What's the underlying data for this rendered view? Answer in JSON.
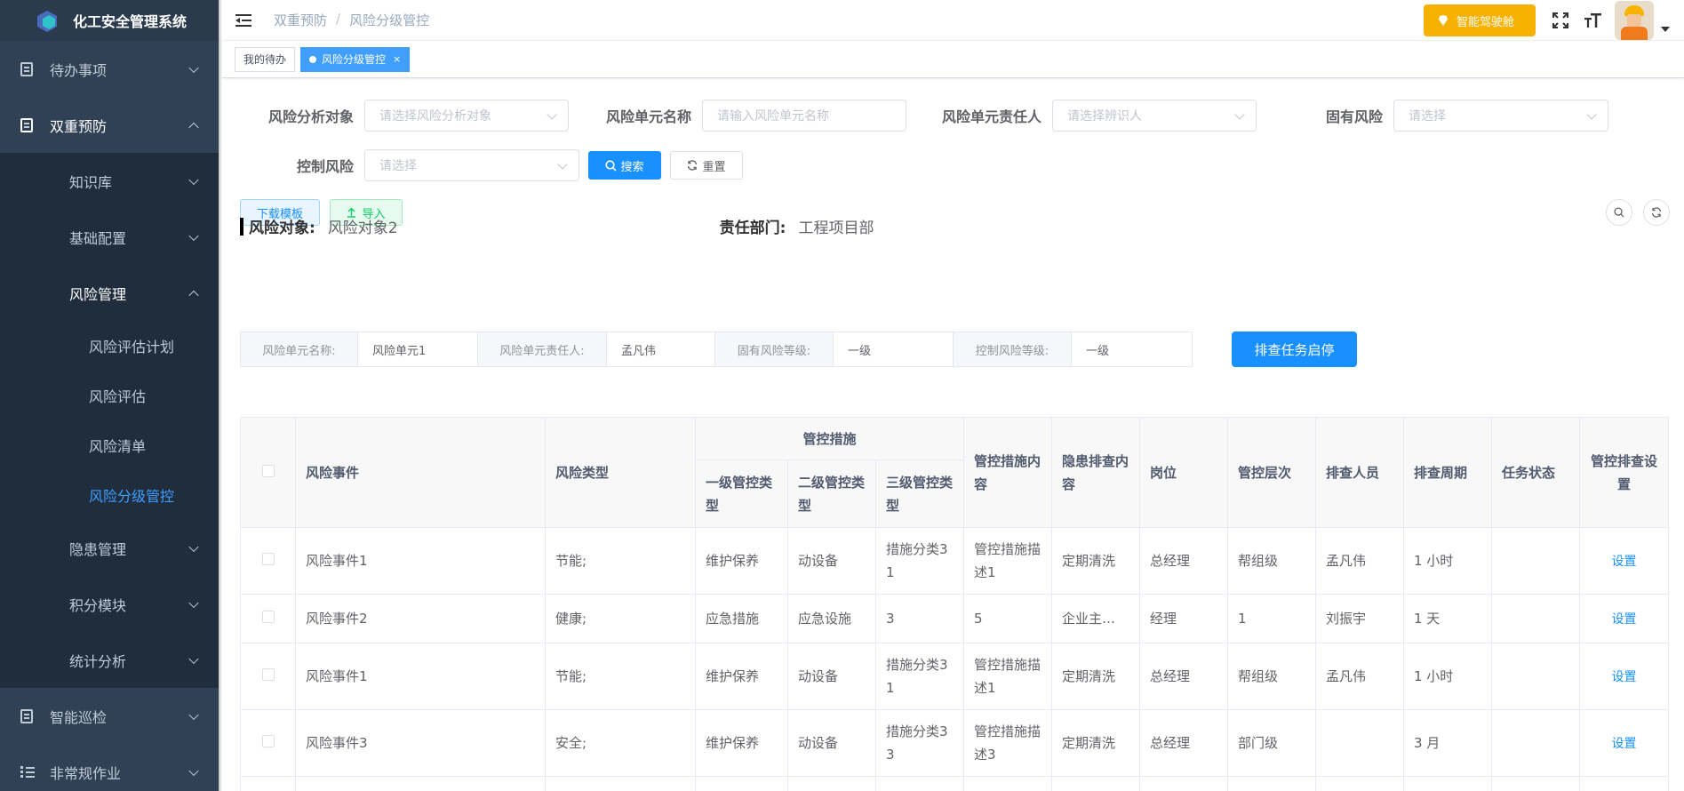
{
  "app": {
    "title": "化工安全管理系统"
  },
  "sidebar": {
    "items": [
      {
        "label": "待办事项"
      },
      {
        "label": "双重预防"
      },
      {
        "label": "知识库"
      },
      {
        "label": "基础配置"
      },
      {
        "label": "风险管理"
      },
      {
        "label": "风险评估计划"
      },
      {
        "label": "风险评估"
      },
      {
        "label": "风险清单"
      },
      {
        "label": "风险分级管控"
      },
      {
        "label": "隐患管理"
      },
      {
        "label": "积分模块"
      },
      {
        "label": "统计分析"
      },
      {
        "label": "智能巡检"
      },
      {
        "label": "非常规作业"
      }
    ]
  },
  "breadcrumb": [
    "双重预防",
    "风险分级管控"
  ],
  "header": {
    "smart_btn": "智能驾驶舱"
  },
  "tags": [
    {
      "label": "我的待办"
    },
    {
      "label": "风险分级管控",
      "close": "×"
    }
  ],
  "filters": {
    "object": {
      "label": "风险分析对象",
      "placeholder": "请选择风险分析对象"
    },
    "unit_name": {
      "label": "风险单元名称",
      "placeholder": "请输入风险单元名称"
    },
    "unit_owner": {
      "label": "风险单元责任人",
      "placeholder": "请选择辨识人"
    },
    "inherent": {
      "label": "固有风险",
      "placeholder": "请选择"
    },
    "control": {
      "label": "控制风险",
      "placeholder": "请选择"
    },
    "search": "搜索",
    "reset": "重置"
  },
  "toolbar": {
    "download": "下载模板",
    "import": "导入"
  },
  "risk_object": {
    "label": "风险对象:",
    "value": "风险对象2",
    "dept_label": "责任部门:",
    "dept_value": "工程项目部"
  },
  "unit_desc": {
    "name_label": "风险单元名称:",
    "name_value": "风险单元1",
    "owner_label": "风险单元责任人:",
    "owner_value": "孟凡伟",
    "inherent_label": "固有风险等级:",
    "inherent_value": "一级",
    "control_label": "控制风险等级:",
    "control_value": "一级",
    "task_btn": "排查任务启停"
  },
  "table": {
    "headers": {
      "event": "风险事件",
      "type": "风险类型",
      "measures": "管控措施",
      "l1": "一级管控类型",
      "l2": "二级管控类型",
      "l3": "三级管控类型",
      "content": "管控措施内容",
      "hazard": "隐患排查内容",
      "post": "岗位",
      "level": "管控层次",
      "person": "排查人员",
      "cycle": "排查周期",
      "status": "任务状态",
      "setting": "管控排查设置"
    },
    "rows": [
      {
        "event": "风险事件1",
        "type": "节能;",
        "l1": "维护保养",
        "l2": "动设备",
        "l3": "措施分类3 1",
        "content": "管控措施描述1",
        "hazard": "定期清洗",
        "post": "总经理",
        "level": "帮组级",
        "person": "孟凡伟",
        "cycle": "1 小时",
        "status": "",
        "action": "设置"
      },
      {
        "event": "风险事件2",
        "type": "健康;",
        "l1": "应急措施",
        "l2": "应急设施",
        "l3": "3",
        "content": "5",
        "hazard": "企业主…",
        "post": "经理",
        "level": "1",
        "person": "刘振宇",
        "cycle": "1 天",
        "status": "",
        "action": "设置"
      },
      {
        "event": "风险事件1",
        "type": "节能;",
        "l1": "维护保养",
        "l2": "动设备",
        "l3": "措施分类3 1",
        "content": "管控措施描述1",
        "hazard": "定期清洗",
        "post": "总经理",
        "level": "帮组级",
        "person": "孟凡伟",
        "cycle": "1 小时",
        "status": "",
        "action": "设置"
      },
      {
        "event": "风险事件3",
        "type": "安全;",
        "l1": "维护保养",
        "l2": "动设备",
        "l3": "措施分类3 3",
        "content": "管控措施描述3",
        "hazard": "定期清洗",
        "post": "总经理",
        "level": "部门级",
        "person": "",
        "cycle": "3 月",
        "status": "",
        "action": "设置"
      }
    ]
  }
}
